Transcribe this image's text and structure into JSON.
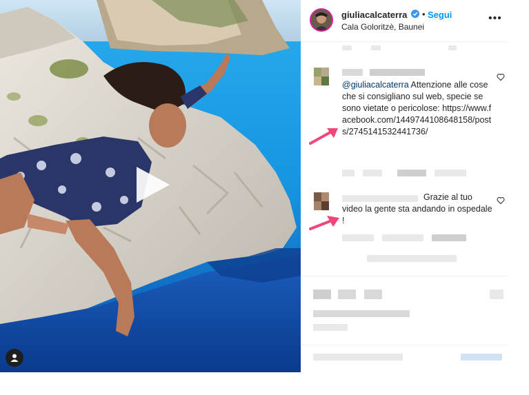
{
  "post": {
    "username": "giuliacalcaterra",
    "follow_label": "Segui",
    "separator": "•",
    "location": "Cala Goloritzè, Baunei",
    "more_label": "•••"
  },
  "comments": [
    {
      "mention": "@giuliacalcaterra",
      "text": " Attenzione alle cose che si consigliano sul web, specie se sono vietate o pericolose: ",
      "link": "https://www.facebook.com/1449744108648158/posts/2745141532441736/"
    },
    {
      "text": "Grazie al tuo video la gente sta andando in ospedale !"
    }
  ],
  "colors": {
    "accent": "#0095f6",
    "arrow": "#f0467a",
    "sea": "#1aa0e6",
    "rock": "#d8d4cc"
  },
  "icons": {
    "verified": "verified-badge-icon",
    "heart": "heart-outline-icon",
    "play": "play-icon",
    "user": "user-icon"
  }
}
